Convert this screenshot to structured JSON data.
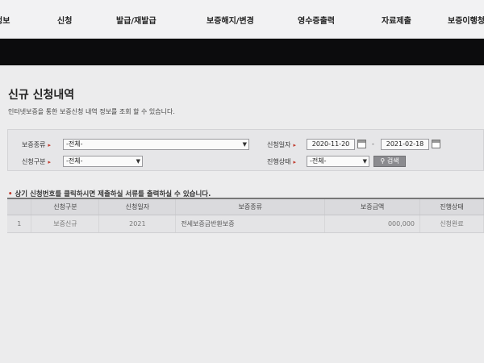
{
  "topnav": {
    "items": [
      "정보",
      "신청",
      "발급/재발급",
      "보증해지/변경",
      "영수증출력",
      "자료제출",
      "보증이행청"
    ]
  },
  "page": {
    "title": "신규 신청내역",
    "description": "인터넷보증을 통한 보증신청 내역 정보를 조회 할 수 있습니다."
  },
  "search": {
    "guarantee_type_label": "보증종류",
    "guarantee_type_value": "-전체-",
    "apply_type_label": "신청구분",
    "apply_type_value": "-전체-",
    "apply_date_label": "신청일자",
    "date_from": "2020-11-20",
    "date_sep": "-",
    "date_to": "2021-02-18",
    "status_label": "진행상태",
    "status_value": "-전체-",
    "search_button": "검색"
  },
  "notice": "상기 신청번호를 클릭하시면 제출하실 서류를 출력하실 수 있습니다.",
  "table": {
    "headers": [
      "",
      "신청구분",
      "신청일자",
      "보증종류",
      "보증금액",
      "진행상태"
    ],
    "rows": [
      [
        "1",
        "보증신규",
        "2021",
        "전세보증금반환보증",
        "000,000",
        "신청완료"
      ]
    ]
  }
}
